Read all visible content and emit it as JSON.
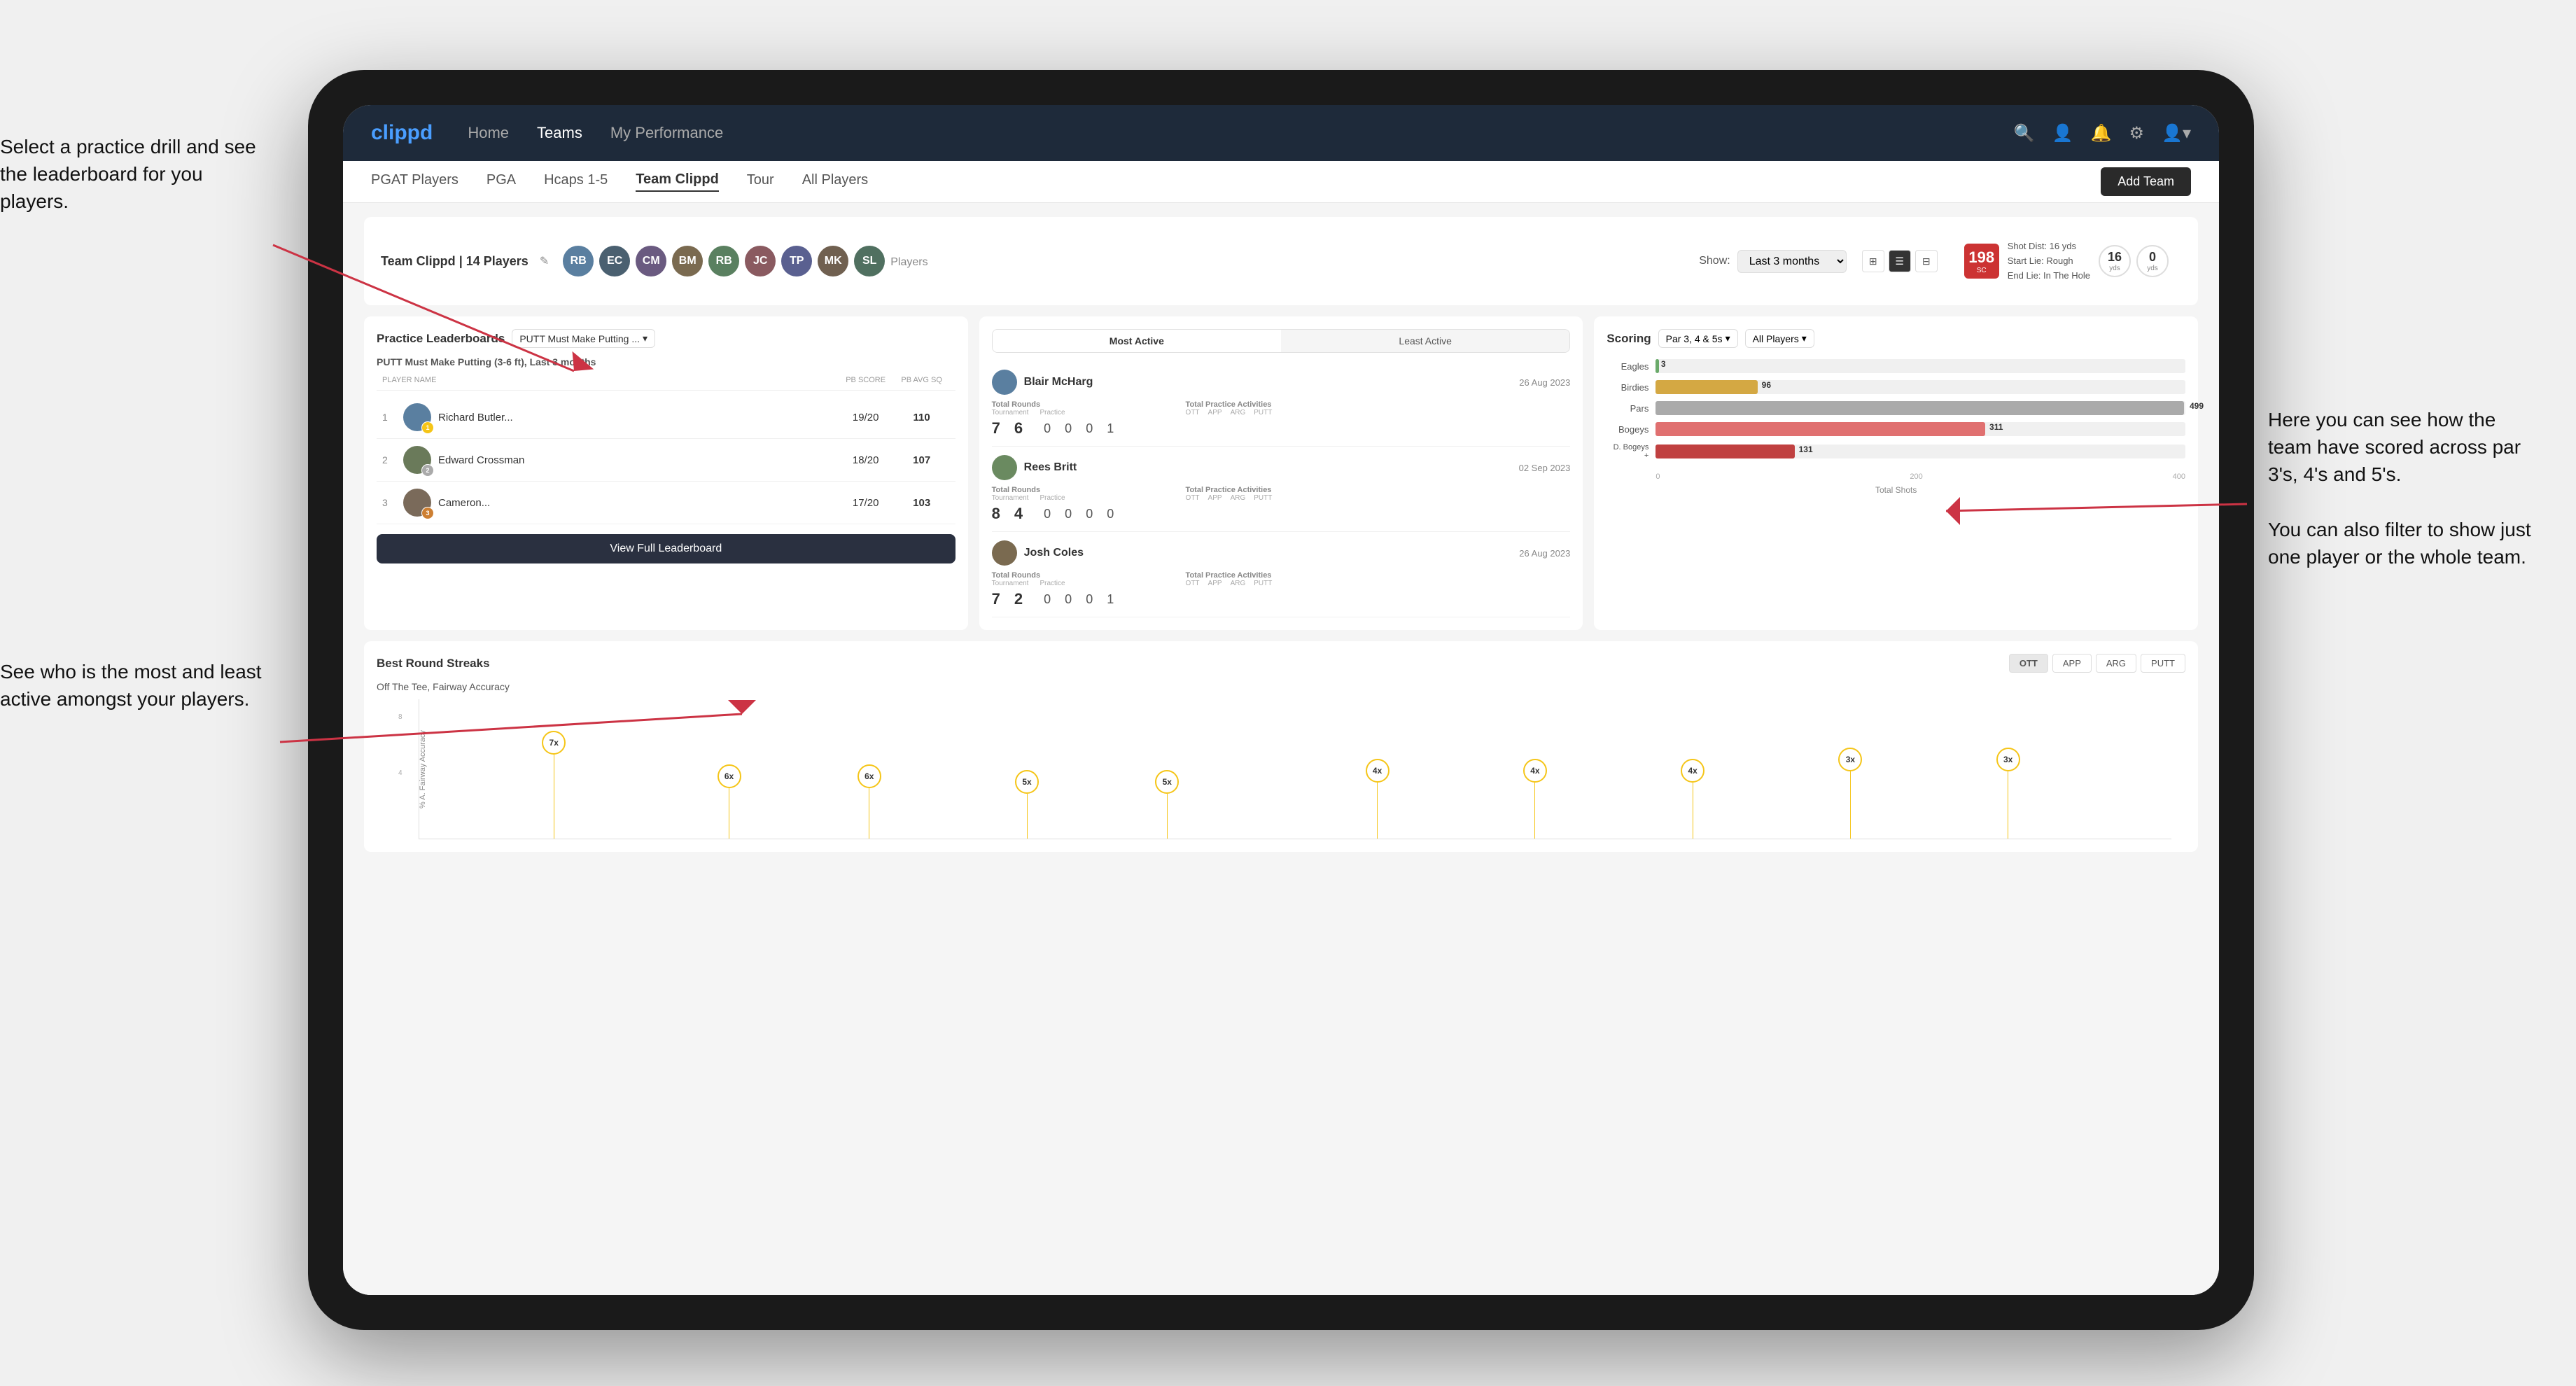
{
  "annotations": {
    "left_top": "Select a practice drill and see the leaderboard for you players.",
    "left_bottom": "See who is the most and least active amongst your players.",
    "right": "Here you can see how the team have scored across par 3's, 4's and 5's.\n\nYou can also filter to show just one player or the whole team."
  },
  "nav": {
    "logo": "clippd",
    "links": [
      "Home",
      "Teams",
      "My Performance"
    ],
    "active_link": "Teams"
  },
  "sub_nav": {
    "links": [
      "PGAT Players",
      "PGA",
      "Hcaps 1-5",
      "Team Clippd",
      "Tour",
      "All Players"
    ],
    "active_link": "Team Clippd",
    "add_team_label": "Add Team"
  },
  "team_header": {
    "title": "Team Clippd",
    "player_count": "14 Players",
    "show_label": "Show:",
    "show_value": "Last 3 months",
    "players_label": "Players"
  },
  "shot_card": {
    "number": "198",
    "unit": "SC",
    "info_line1": "Shot Dist: 16 yds",
    "info_line2": "Start Lie: Rough",
    "info_line3": "End Lie: In The Hole",
    "yds1": "16",
    "yds1_label": "yds",
    "yds2": "0",
    "yds2_label": "yds"
  },
  "practice_leaderboard": {
    "title": "Practice Leaderboards",
    "dropdown": "PUTT Must Make Putting ...",
    "subtitle_drill": "PUTT Must Make Putting (3-6 ft),",
    "subtitle_period": "Last 3 months",
    "col_player": "PLAYER NAME",
    "col_score": "PB SCORE",
    "col_avg": "PB AVG SQ",
    "players": [
      {
        "rank": 1,
        "name": "Richard Butler...",
        "badge": "gold",
        "badge_num": "1",
        "score": "19/20",
        "avg": "110"
      },
      {
        "rank": 2,
        "name": "Edward Crossman",
        "badge": "silver",
        "badge_num": "2",
        "score": "18/20",
        "avg": "107"
      },
      {
        "rank": 3,
        "name": "Cameron...",
        "badge": "bronze",
        "badge_num": "3",
        "score": "17/20",
        "avg": "103"
      }
    ],
    "view_full_label": "View Full Leaderboard"
  },
  "activity": {
    "tabs": [
      "Most Active",
      "Least Active"
    ],
    "active_tab": "Most Active",
    "players": [
      {
        "name": "Blair McHarg",
        "date": "26 Aug 2023",
        "total_rounds_label": "Total Rounds",
        "tournament_label": "Tournament",
        "practice_label": "Practice",
        "tournament_val": "7",
        "practice_val": "6",
        "total_practice_label": "Total Practice Activities",
        "ott_label": "OTT",
        "app_label": "APP",
        "arg_label": "ARG",
        "putt_label": "PUTT",
        "ott_val": "0",
        "app_val": "0",
        "arg_val": "0",
        "putt_val": "1"
      },
      {
        "name": "Rees Britt",
        "date": "02 Sep 2023",
        "total_rounds_label": "Total Rounds",
        "tournament_label": "Tournament",
        "practice_label": "Practice",
        "tournament_val": "8",
        "practice_val": "4",
        "total_practice_label": "Total Practice Activities",
        "ott_label": "OTT",
        "app_label": "APP",
        "arg_label": "ARG",
        "putt_label": "PUTT",
        "ott_val": "0",
        "app_val": "0",
        "arg_val": "0",
        "putt_val": "0"
      },
      {
        "name": "Josh Coles",
        "date": "26 Aug 2023",
        "total_rounds_label": "Total Rounds",
        "tournament_label": "Tournament",
        "practice_label": "Practice",
        "tournament_val": "7",
        "practice_val": "2",
        "total_practice_label": "Total Practice Activities",
        "ott_label": "OTT",
        "app_label": "APP",
        "arg_label": "ARG",
        "putt_label": "PUTT",
        "ott_val": "0",
        "app_val": "0",
        "arg_val": "0",
        "putt_val": "1"
      }
    ]
  },
  "scoring": {
    "title": "Scoring",
    "filter1": "Par 3, 4 & 5s",
    "filter2": "All Players",
    "bars": [
      {
        "label": "Eagles",
        "value": 3,
        "max": 500,
        "type": "eagles"
      },
      {
        "label": "Birdies",
        "value": 96,
        "max": 500,
        "type": "birdies"
      },
      {
        "label": "Pars",
        "value": 499,
        "max": 500,
        "type": "pars"
      },
      {
        "label": "Bogeys",
        "value": 311,
        "max": 500,
        "type": "bogeys"
      },
      {
        "label": "D. Bogeys +",
        "value": 131,
        "max": 500,
        "type": "dbogeys"
      }
    ],
    "axis_labels": [
      "0",
      "200",
      "400"
    ],
    "total_shots_label": "Total Shots"
  },
  "best_round_streaks": {
    "title": "Best Round Streaks",
    "tabs": [
      "OTT",
      "APP",
      "ARG",
      "PUTT"
    ],
    "active_tab": "OTT",
    "subtitle": "Off The Tee, Fairway Accuracy",
    "y_axis_label": "% A. Fairway Accuracy",
    "dots": [
      {
        "x_pct": 7,
        "y_pct": 25,
        "label": "7x"
      },
      {
        "x_pct": 17,
        "y_pct": 55,
        "label": "6x"
      },
      {
        "x_pct": 25,
        "y_pct": 55,
        "label": "6x"
      },
      {
        "x_pct": 34,
        "y_pct": 60,
        "label": "5x"
      },
      {
        "x_pct": 42,
        "y_pct": 60,
        "label": "5x"
      },
      {
        "x_pct": 54,
        "y_pct": 50,
        "label": "4x"
      },
      {
        "x_pct": 63,
        "y_pct": 50,
        "label": "4x"
      },
      {
        "x_pct": 72,
        "y_pct": 50,
        "label": "4x"
      },
      {
        "x_pct": 81,
        "y_pct": 40,
        "label": "3x"
      },
      {
        "x_pct": 90,
        "y_pct": 40,
        "label": "3x"
      }
    ]
  }
}
